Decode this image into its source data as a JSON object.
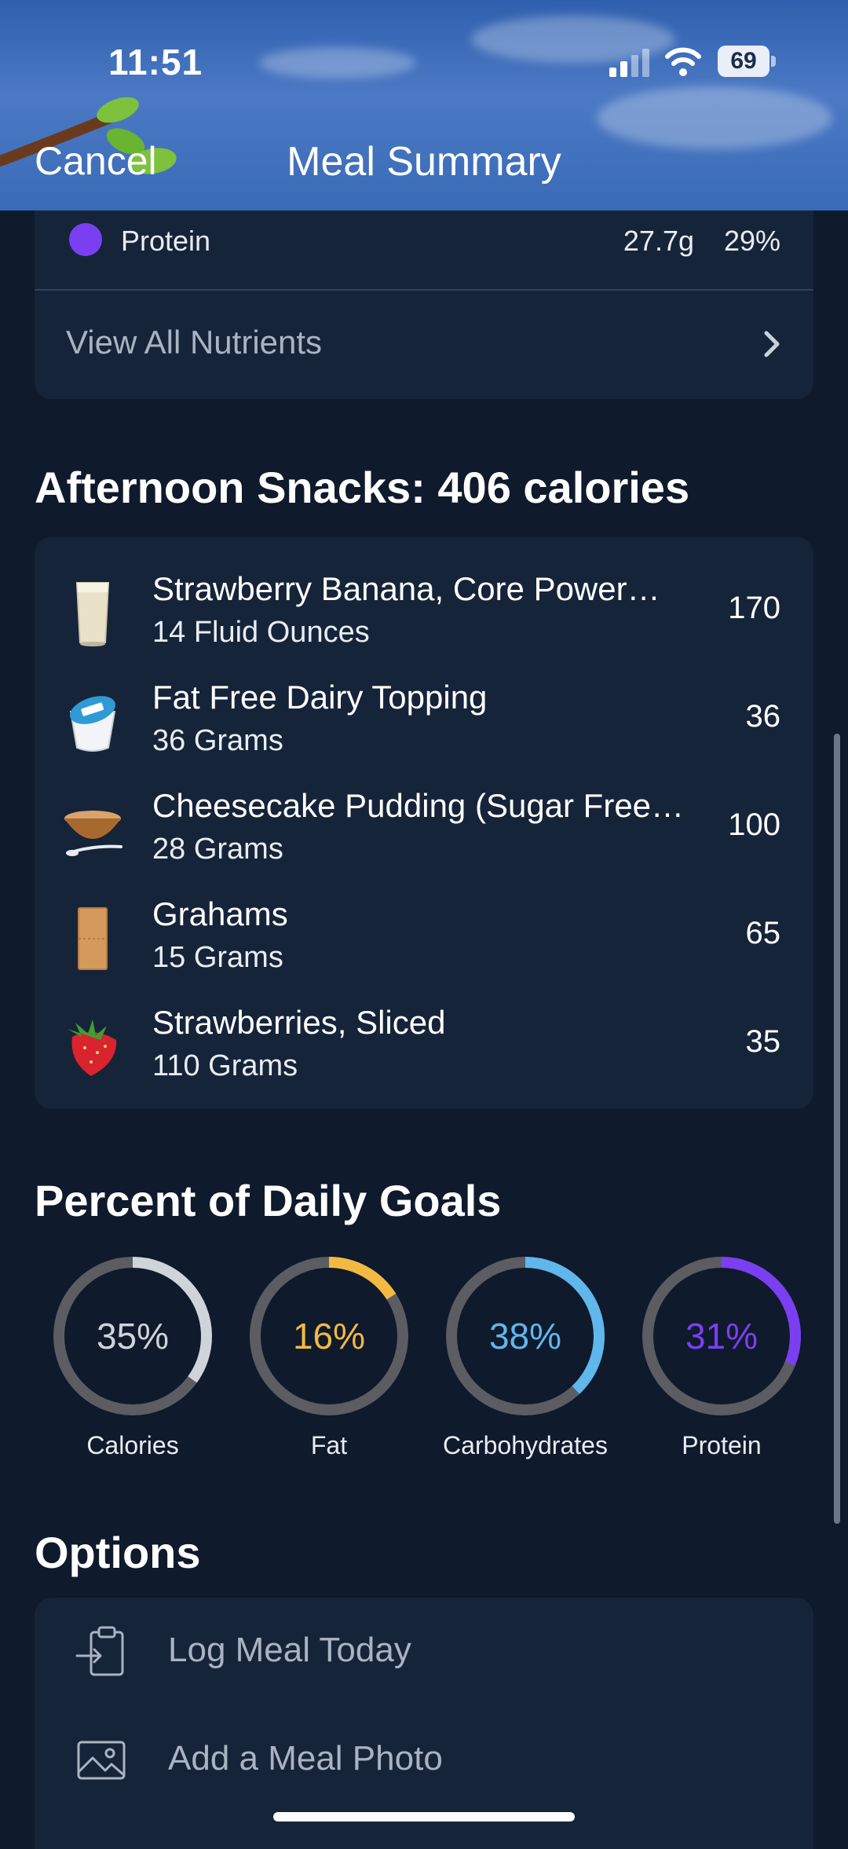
{
  "status_bar": {
    "time": "11:51",
    "battery": "69"
  },
  "nav": {
    "cancel_label": "Cancel",
    "title": "Meal Summary"
  },
  "nutrients": {
    "protein_label": "Protein",
    "protein_grams": "27.7g",
    "protein_percent": "29%",
    "protein_color": "#7b3ff2",
    "view_all_label": "View All Nutrients"
  },
  "meal": {
    "title": "Afternoon Snacks: 406 calories",
    "items": [
      {
        "name": "Strawberry Banana, Core Power…",
        "quantity": "14 Fluid Ounces",
        "calories": "170",
        "icon": "milk-glass-icon"
      },
      {
        "name": "Fat Free Dairy Topping",
        "quantity": "36 Grams",
        "calories": "36",
        "icon": "cream-cup-icon"
      },
      {
        "name": "Cheesecake Pudding (Sugar Free…",
        "quantity": "28 Grams",
        "calories": "100",
        "icon": "bowl-spoon-icon"
      },
      {
        "name": "Grahams",
        "quantity": "15 Grams",
        "calories": "65",
        "icon": "graham-cracker-icon"
      },
      {
        "name": "Strawberries, Sliced",
        "quantity": "110 Grams",
        "calories": "35",
        "icon": "strawberry-icon"
      }
    ]
  },
  "goals": {
    "title": "Percent of Daily Goals",
    "items": [
      {
        "label": "Calories",
        "percent_text": "35%",
        "percent": 35,
        "color": "#cfd3da"
      },
      {
        "label": "Fat",
        "percent_text": "16%",
        "percent": 16,
        "color": "#f4b942"
      },
      {
        "label": "Carbohydrates",
        "percent_text": "38%",
        "percent": 38,
        "color": "#5fb7ec"
      },
      {
        "label": "Protein",
        "percent_text": "31%",
        "percent": 31,
        "color": "#7b3ff2"
      }
    ]
  },
  "options": {
    "title": "Options",
    "items": [
      {
        "label": "Log Meal Today",
        "icon": "clipboard-log-icon"
      },
      {
        "label": "Add a Meal Photo",
        "icon": "photo-icon"
      }
    ]
  }
}
